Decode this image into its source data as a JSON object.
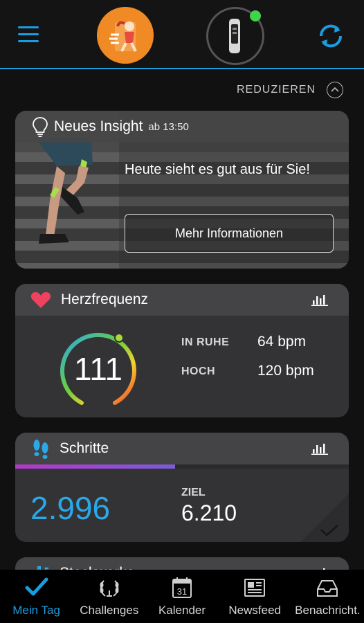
{
  "header": {
    "menu_icon": "hamburger-menu-icon",
    "avatar_icon": "runner-avatar-icon",
    "device_icon": "fitness-tracker-icon",
    "sync_icon": "sync-icon",
    "accent_color": "#1a9de0",
    "device_status_color": "#3fd44a"
  },
  "collapse": {
    "label": "REDUZIEREN",
    "icon": "chevron-up-circle-icon"
  },
  "insight": {
    "icon": "lightbulb-icon",
    "title": "Neues Insight",
    "time": "ab 13:50",
    "message": "Heute sieht es gut aus für Sie!",
    "button_label": "Mehr Informationen"
  },
  "heart_rate": {
    "icon": "heart-icon",
    "title": "Herzfrequenz",
    "value": "111",
    "rows": [
      {
        "label": "IN RUHE",
        "value": "64 bpm"
      },
      {
        "label": "HOCH",
        "value": "120 bpm"
      }
    ],
    "chart_icon": "bar-chart-icon"
  },
  "steps": {
    "icon": "footsteps-icon",
    "title": "Schritte",
    "value": "2.996",
    "goal_label": "ZIEL",
    "goal_value": "6.210",
    "progress": 0.48,
    "chart_icon": "bar-chart-icon",
    "value_color": "#2aa8e8"
  },
  "stairs": {
    "icon": "stairs-icon",
    "title": "Stockwerke"
  },
  "bottom_nav": [
    {
      "label": "Mein Tag",
      "icon": "checkmark-icon",
      "active": true
    },
    {
      "label": "Challenges",
      "icon": "laurel-wreath-icon",
      "active": false
    },
    {
      "label": "Kalender",
      "icon": "calendar-icon",
      "active": false,
      "icon_text": "31"
    },
    {
      "label": "Newsfeed",
      "icon": "newspaper-icon",
      "active": false
    },
    {
      "label": "Benachricht.",
      "icon": "inbox-tray-icon",
      "active": false
    }
  ]
}
